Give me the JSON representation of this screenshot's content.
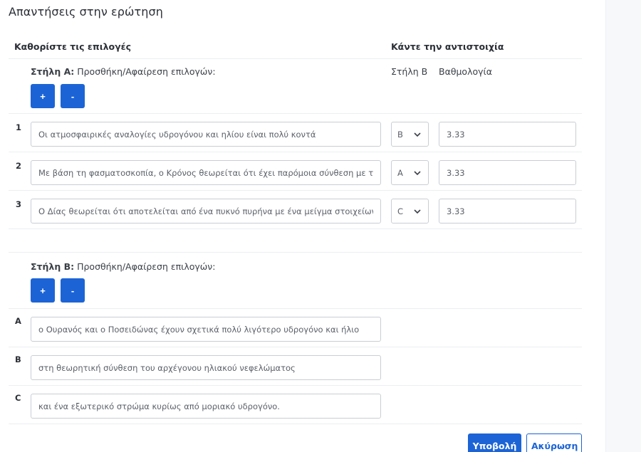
{
  "title": "Απαντήσεις στην ερώτηση",
  "left_header": "Καθορίστε τις επιλογές",
  "right_header": "Κάντε την αντιστοιχία",
  "column_a": {
    "label_bold": "Στήλη Α:",
    "label_rest": " Προσθήκη/Αφαίρεση επιλογών:",
    "add_label": "+",
    "remove_label": "-",
    "rows": [
      {
        "num": "1",
        "text": "Οι ατμοσφαιρικές αναλογίες υδρογόνου και ηλίου είναι πολύ κοντά",
        "match": "B",
        "score": "3.33"
      },
      {
        "num": "2",
        "text": "Με βάση τη φασματοσκοπία, ο Κρόνος θεωρείται ότι έχει παρόμοια σύνθεση με τον",
        "match": "A",
        "score": "3.33"
      },
      {
        "num": "3",
        "text": "Ο Δίας θεωρείται ότι αποτελείται από ένα πυκνό πυρήνα με ένα μείγμα στοιχείων, έν",
        "match": "C",
        "score": "3.33"
      }
    ]
  },
  "column_b_header": "Στήλη Β",
  "score_header": "Βαθμολογία",
  "column_b": {
    "label_bold": "Στήλη Β:",
    "label_rest": " Προσθήκη/Αφαίρεση επιλογών:",
    "add_label": "+",
    "remove_label": "-",
    "rows": [
      {
        "letter": "A",
        "text": "ο Ουρανός και ο Ποσειδώνας έχουν σχετικά πολύ λιγότερο υδρογόνο και ήλιο"
      },
      {
        "letter": "B",
        "text": "στη θεωρητική σύνθεση του αρχέγονου ηλιακού νεφελώματος"
      },
      {
        "letter": "C",
        "text": "και ένα εξωτερικό στρώμα κυρίως από μοριακό υδρογόνο."
      }
    ]
  },
  "submit_label": "Υποβολή",
  "cancel_label": "Ακύρωση",
  "colors": {
    "accent": "#1c64d6",
    "border": "#c9cdd3",
    "divider": "#eceef1"
  },
  "icons": {
    "select_chevron": "chevron-down-icon"
  }
}
